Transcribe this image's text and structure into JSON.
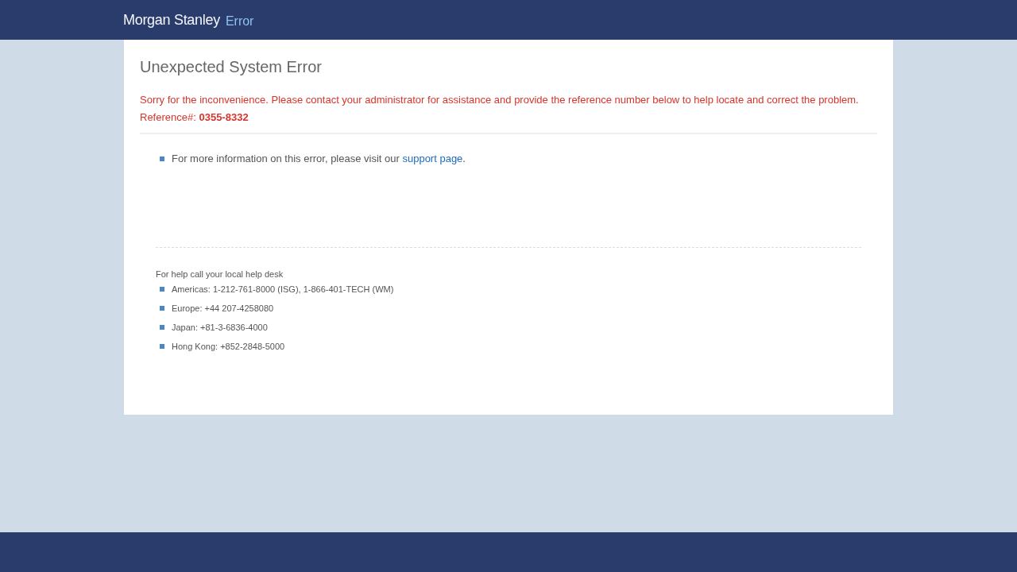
{
  "header": {
    "logo": "Morgan Stanley",
    "section": "Error"
  },
  "error": {
    "title": "Unexpected System Error",
    "message": "Sorry for the inconvenience. Please contact your administrator for assistance and provide the reference number below to help locate and correct the problem.",
    "reference": "Reference#: **0355-8332**"
  },
  "info": [
    {
      "text": "For more information on this error, please visit our ",
      "link": "support page",
      "after": "."
    }
  ],
  "help": {
    "heading": "For help call your local help desk",
    "items": [
      "Americas: 1-212-761-8000 (ISG), 1-866-401-TECH (WM)",
      "Europe: +44 207-4258080",
      "Japan: +81-3-6836-4000",
      "Hong Kong: +852-2848-5000"
    ]
  }
}
